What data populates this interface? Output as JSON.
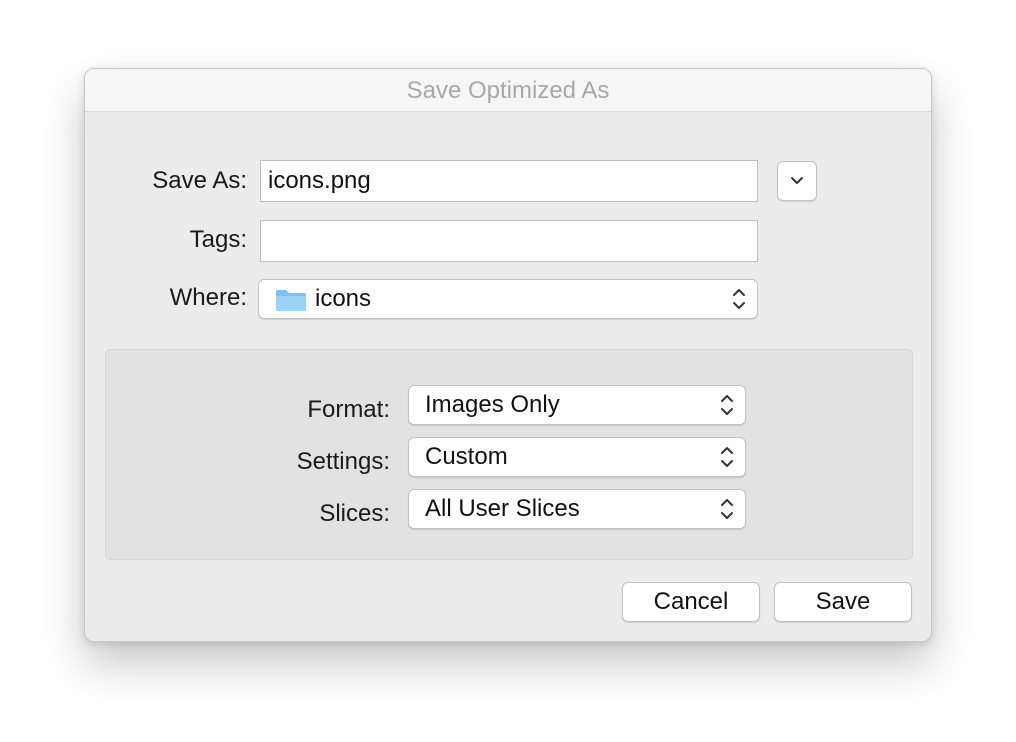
{
  "dialog": {
    "title": "Save Optimized As"
  },
  "save_as": {
    "label": "Save As:",
    "value": "icons.png"
  },
  "tags": {
    "label": "Tags:",
    "value": "",
    "placeholder": ""
  },
  "where": {
    "label": "Where:",
    "value": "icons",
    "icon": "folder-icon"
  },
  "expand_button": {
    "icon": "chevron-down-icon"
  },
  "options": {
    "format": {
      "label": "Format:",
      "value": "Images Only"
    },
    "settings": {
      "label": "Settings:",
      "value": "Custom"
    },
    "slices": {
      "label": "Slices:",
      "value": "All User Slices"
    }
  },
  "buttons": {
    "cancel_label": "Cancel",
    "save_label": "Save"
  },
  "colors": {
    "folder_blue": "#7cc3f0",
    "title_gray": "#a8a8a8",
    "panel_bg": "#e2e2e2"
  }
}
